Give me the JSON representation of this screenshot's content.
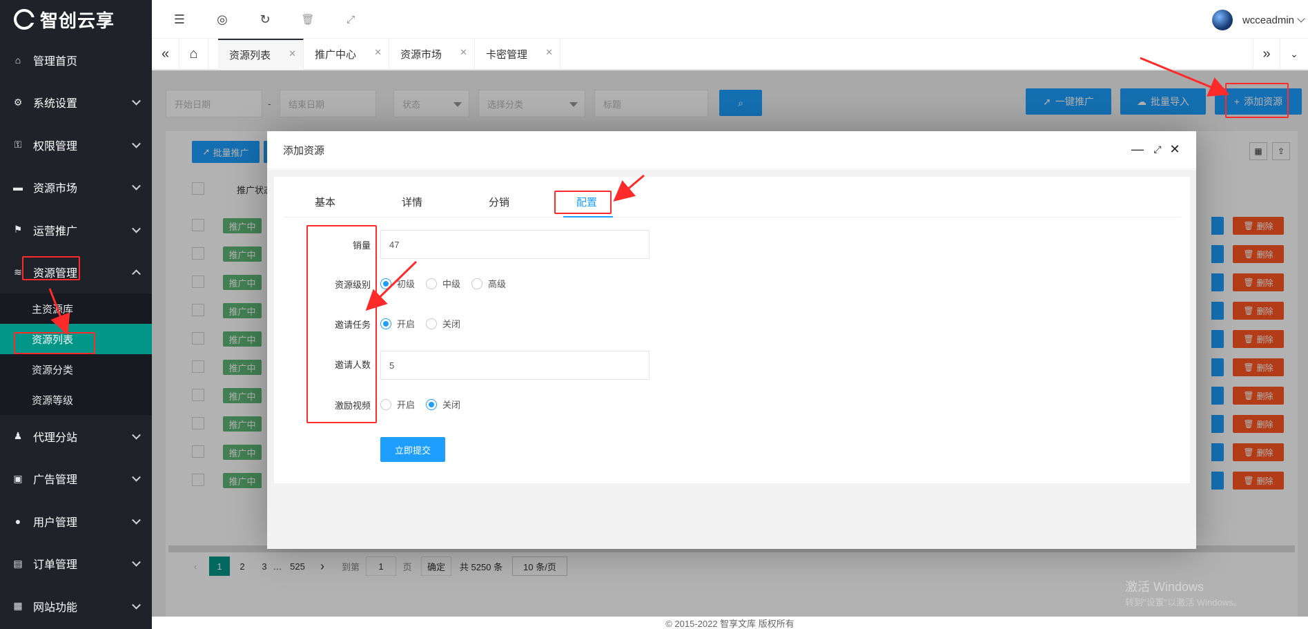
{
  "brand": {
    "name": "智创云享"
  },
  "sidebar": {
    "items": [
      {
        "label": "管理首页",
        "icon": "home-icon"
      },
      {
        "label": "系统设置",
        "icon": "gear-icon"
      },
      {
        "label": "权限管理",
        "icon": "key-icon"
      },
      {
        "label": "资源市场",
        "icon": "store-icon"
      },
      {
        "label": "运营推广",
        "icon": "flag-icon"
      },
      {
        "label": "资源管理",
        "icon": "layers-icon",
        "expanded": true
      },
      {
        "label": "代理分站",
        "icon": "agent-icon"
      },
      {
        "label": "广告管理",
        "icon": "ad-icon"
      },
      {
        "label": "用户管理",
        "icon": "user-icon"
      },
      {
        "label": "订单管理",
        "icon": "clipboard-icon"
      },
      {
        "label": "网站功能",
        "icon": "grid-icon"
      }
    ],
    "submenu": [
      {
        "label": "主资源库"
      },
      {
        "label": "资源列表",
        "active": true
      },
      {
        "label": "资源分类"
      },
      {
        "label": "资源等级"
      }
    ]
  },
  "topbar": {
    "username": "wcceadmin"
  },
  "tabs": [
    {
      "label": "资源列表",
      "active": true
    },
    {
      "label": "推广中心"
    },
    {
      "label": "资源市场"
    },
    {
      "label": "卡密管理"
    }
  ],
  "filters": {
    "start_date": "开始日期",
    "dash": "-",
    "end_date": "结束日期",
    "status": "状态",
    "category": "选择分类",
    "title": "标题"
  },
  "actions": {
    "one_click_promote": "一键推广",
    "batch_import": "批量导入",
    "add_resource": "添加资源",
    "batch_promote": "批量推广"
  },
  "table": {
    "header_status": "推广状态",
    "row_status": "推广中",
    "delete_label": "删除",
    "row_count": 10
  },
  "pagination": {
    "pages": [
      "1",
      "2",
      "3",
      "…",
      "525"
    ],
    "goto_label": "到第",
    "goto_value": "1",
    "page_unit": "页",
    "confirm": "确定",
    "total": "共 5250 条",
    "per_page": "10 条/页"
  },
  "modal": {
    "title": "添加资源",
    "tabs": [
      "基本",
      "详情",
      "分销",
      "配置"
    ],
    "active_tab": "配置",
    "fields": {
      "sales_label": "销量",
      "sales_value": "47",
      "level_label": "资源级别",
      "level_options": [
        "初级",
        "中级",
        "高级"
      ],
      "level_selected": "初级",
      "invite_task_label": "邀请任务",
      "invite_task_options": [
        "开启",
        "关闭"
      ],
      "invite_task_selected": "开启",
      "invite_count_label": "邀请人数",
      "invite_count_value": "5",
      "incentive_video_label": "激励视频",
      "incentive_video_options": [
        "开启",
        "关闭"
      ],
      "incentive_video_selected": "关闭"
    },
    "submit": "立即提交"
  },
  "footer": {
    "copyright": "© 2015-2022 智享文库 版权所有"
  },
  "watermark": {
    "line1": "激活 Windows",
    "line2": "转到\"设置\"以激活 Windows。"
  },
  "colors": {
    "accent": "#1e9fff",
    "active_menu": "#009688",
    "sidebar": "#20222a",
    "danger": "#ff5722",
    "success": "#5fb878",
    "annotation": "#ff2a2a"
  }
}
